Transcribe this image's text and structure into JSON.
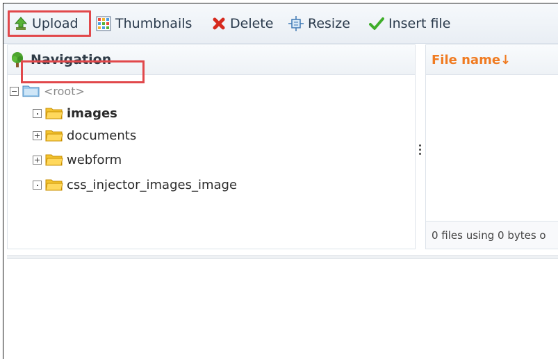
{
  "toolbar": {
    "upload_label": "Upload",
    "thumbnails_label": "Thumbnails",
    "delete_label": "Delete",
    "resize_label": "Resize",
    "insert_label": "Insert file"
  },
  "navigation": {
    "title": "Navigation",
    "tree": {
      "root_label": "<root>",
      "items": [
        {
          "label": "images",
          "selected": true,
          "expander": "none"
        },
        {
          "label": "documents",
          "selected": false,
          "expander": "plus"
        },
        {
          "label": "webform",
          "selected": false,
          "expander": "plus"
        },
        {
          "label": "css_injector_images_image",
          "selected": false,
          "expander": "none"
        }
      ]
    }
  },
  "files": {
    "column_header": "File name↓",
    "status": "0 files using 0 bytes o"
  },
  "colors": {
    "highlight": "#e1484b",
    "header_accent": "#f07b21",
    "folder": "#f4c430"
  }
}
